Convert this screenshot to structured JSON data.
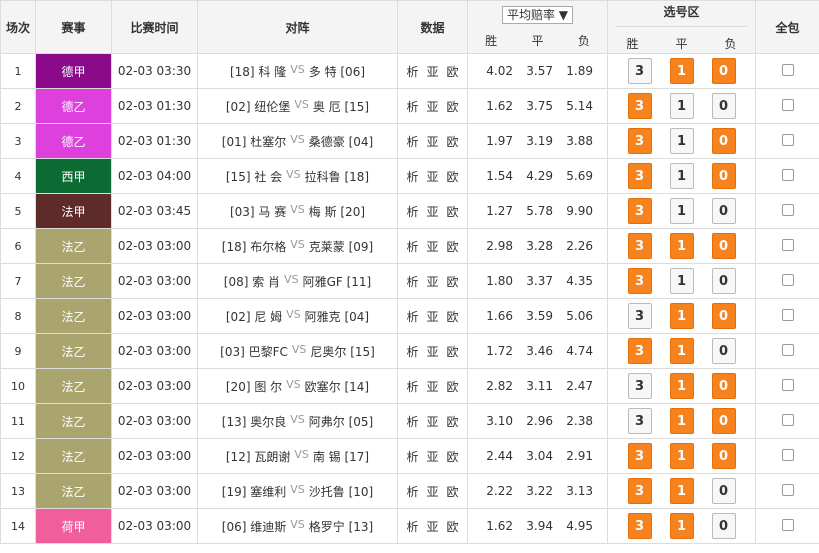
{
  "header": {
    "col_index": "场次",
    "col_league": "赛事",
    "col_time": "比赛时间",
    "col_match": "对阵",
    "col_data": "数据",
    "col_odds_select": "平均赔率",
    "odds_sub": [
      "胜",
      "平",
      "负"
    ],
    "col_selection": "选号区",
    "selection_sub": [
      "胜",
      "平",
      "负"
    ],
    "col_all": "全包"
  },
  "colors": {
    "bundesliga": "#8a0a8a",
    "bundesliga2": "#de40de",
    "laliga": "#0b6b33",
    "ligue1": "#5e2a2a",
    "ligue2": "#aaa56e",
    "eredivisie": "#f05e9c",
    "selected_option": "#f7831e"
  },
  "data_links": [
    "析",
    "亚",
    "欧"
  ],
  "rows": [
    {
      "idx": "1",
      "league": "德甲",
      "color": "#8a0a8a",
      "time": "02-03 03:30",
      "home": "[18] 科 隆",
      "away": "多 特 [06]",
      "win": "4.02",
      "draw": "3.57",
      "lose": "1.89",
      "sel": [
        false,
        true,
        true
      ]
    },
    {
      "idx": "2",
      "league": "德乙",
      "color": "#de40de",
      "time": "02-03 01:30",
      "home": "[02] 纽伦堡",
      "away": "奥 厄 [15]",
      "win": "1.62",
      "draw": "3.75",
      "lose": "5.14",
      "sel": [
        true,
        false,
        false
      ]
    },
    {
      "idx": "3",
      "league": "德乙",
      "color": "#de40de",
      "time": "02-03 01:30",
      "home": "[01] 杜塞尔",
      "away": "桑德豪 [04]",
      "win": "1.97",
      "draw": "3.19",
      "lose": "3.88",
      "sel": [
        true,
        false,
        true
      ]
    },
    {
      "idx": "4",
      "league": "西甲",
      "color": "#0b6b33",
      "time": "02-03 04:00",
      "home": "[15] 社 会",
      "away": "拉科鲁 [18]",
      "win": "1.54",
      "draw": "4.29",
      "lose": "5.69",
      "sel": [
        true,
        false,
        true
      ]
    },
    {
      "idx": "5",
      "league": "法甲",
      "color": "#5e2a2a",
      "time": "02-03 03:45",
      "home": "[03] 马 赛",
      "away": "梅 斯 [20]",
      "win": "1.27",
      "draw": "5.78",
      "lose": "9.90",
      "sel": [
        true,
        false,
        false
      ]
    },
    {
      "idx": "6",
      "league": "法乙",
      "color": "#aaa56e",
      "time": "02-03 03:00",
      "home": "[18] 布尔格",
      "away": "克莱蒙 [09]",
      "win": "2.98",
      "draw": "3.28",
      "lose": "2.26",
      "sel": [
        true,
        true,
        true
      ]
    },
    {
      "idx": "7",
      "league": "法乙",
      "color": "#aaa56e",
      "time": "02-03 03:00",
      "home": "[08] 索 肖",
      "away": "阿雅GF [11]",
      "win": "1.80",
      "draw": "3.37",
      "lose": "4.35",
      "sel": [
        true,
        false,
        false
      ]
    },
    {
      "idx": "8",
      "league": "法乙",
      "color": "#aaa56e",
      "time": "02-03 03:00",
      "home": "[02] 尼 姆",
      "away": "阿雅克 [04]",
      "win": "1.66",
      "draw": "3.59",
      "lose": "5.06",
      "sel": [
        false,
        true,
        true
      ]
    },
    {
      "idx": "9",
      "league": "法乙",
      "color": "#aaa56e",
      "time": "02-03 03:00",
      "home": "[03] 巴黎FC",
      "away": "尼奥尔 [15]",
      "win": "1.72",
      "draw": "3.46",
      "lose": "4.74",
      "sel": [
        true,
        true,
        false
      ]
    },
    {
      "idx": "10",
      "league": "法乙",
      "color": "#aaa56e",
      "time": "02-03 03:00",
      "home": "[20] 图 尔",
      "away": "欧塞尔 [14]",
      "win": "2.82",
      "draw": "3.11",
      "lose": "2.47",
      "sel": [
        false,
        true,
        true
      ]
    },
    {
      "idx": "11",
      "league": "法乙",
      "color": "#aaa56e",
      "time": "02-03 03:00",
      "home": "[13] 奥尔良",
      "away": "阿弗尔 [05]",
      "win": "3.10",
      "draw": "2.96",
      "lose": "2.38",
      "sel": [
        false,
        true,
        true
      ]
    },
    {
      "idx": "12",
      "league": "法乙",
      "color": "#aaa56e",
      "time": "02-03 03:00",
      "home": "[12] 瓦朗谢",
      "away": "南 锡 [17]",
      "win": "2.44",
      "draw": "3.04",
      "lose": "2.91",
      "sel": [
        true,
        true,
        true
      ]
    },
    {
      "idx": "13",
      "league": "法乙",
      "color": "#aaa56e",
      "time": "02-03 03:00",
      "home": "[19] 塞维利",
      "away": "沙托鲁 [10]",
      "win": "2.22",
      "draw": "3.22",
      "lose": "3.13",
      "sel": [
        true,
        true,
        false
      ]
    },
    {
      "idx": "14",
      "league": "荷甲",
      "color": "#f05e9c",
      "time": "02-03 03:00",
      "home": "[06] 维迪斯",
      "away": "格罗宁 [13]",
      "win": "1.62",
      "draw": "3.94",
      "lose": "4.95",
      "sel": [
        true,
        true,
        false
      ]
    }
  ],
  "option_labels": [
    "3",
    "1",
    "0"
  ]
}
